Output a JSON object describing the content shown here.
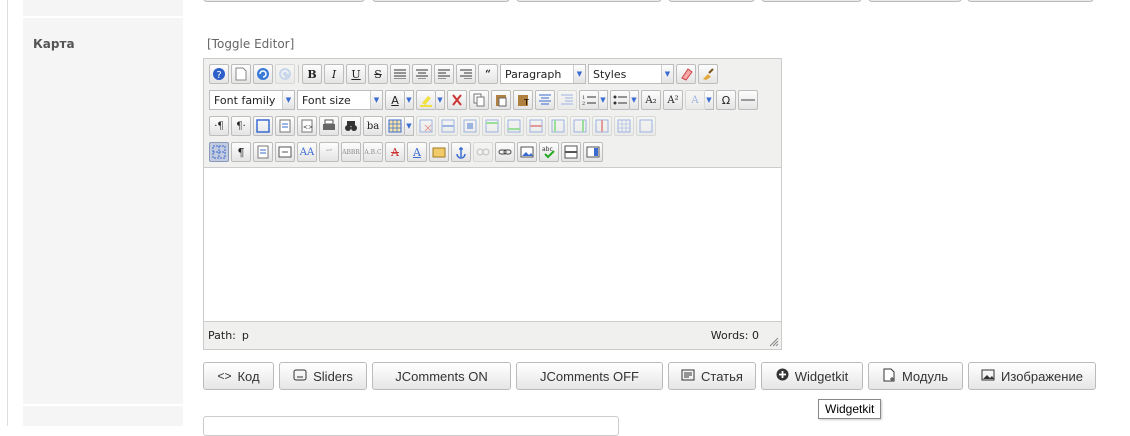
{
  "field": {
    "label": "Карта"
  },
  "editor": {
    "toggle_link": "[Toggle Editor]",
    "format_select": "Paragraph",
    "styles_select": "Styles",
    "font_family_select": "Font family",
    "font_size_select": "Font size",
    "path_label": "Path:",
    "path_value": "p",
    "words_label": "Words: 0"
  },
  "buttons": [
    {
      "label": "Код",
      "icon": "code-icon"
    },
    {
      "label": "Sliders",
      "icon": "slider-icon"
    },
    {
      "label": "JComments ON",
      "icon": ""
    },
    {
      "label": "JComments OFF",
      "icon": ""
    },
    {
      "label": "Статья",
      "icon": "article-icon"
    },
    {
      "label": "Widgetkit",
      "icon": "plus-circle-icon"
    },
    {
      "label": "Модуль",
      "icon": "module-icon"
    },
    {
      "label": "Изображение",
      "icon": "image-icon"
    }
  ],
  "tooltip": "Widgetkit",
  "colors": {
    "label_bg": "#f5f5f5",
    "editor_bg": "#f0f0ee",
    "button_border": "#bbbbbb"
  }
}
